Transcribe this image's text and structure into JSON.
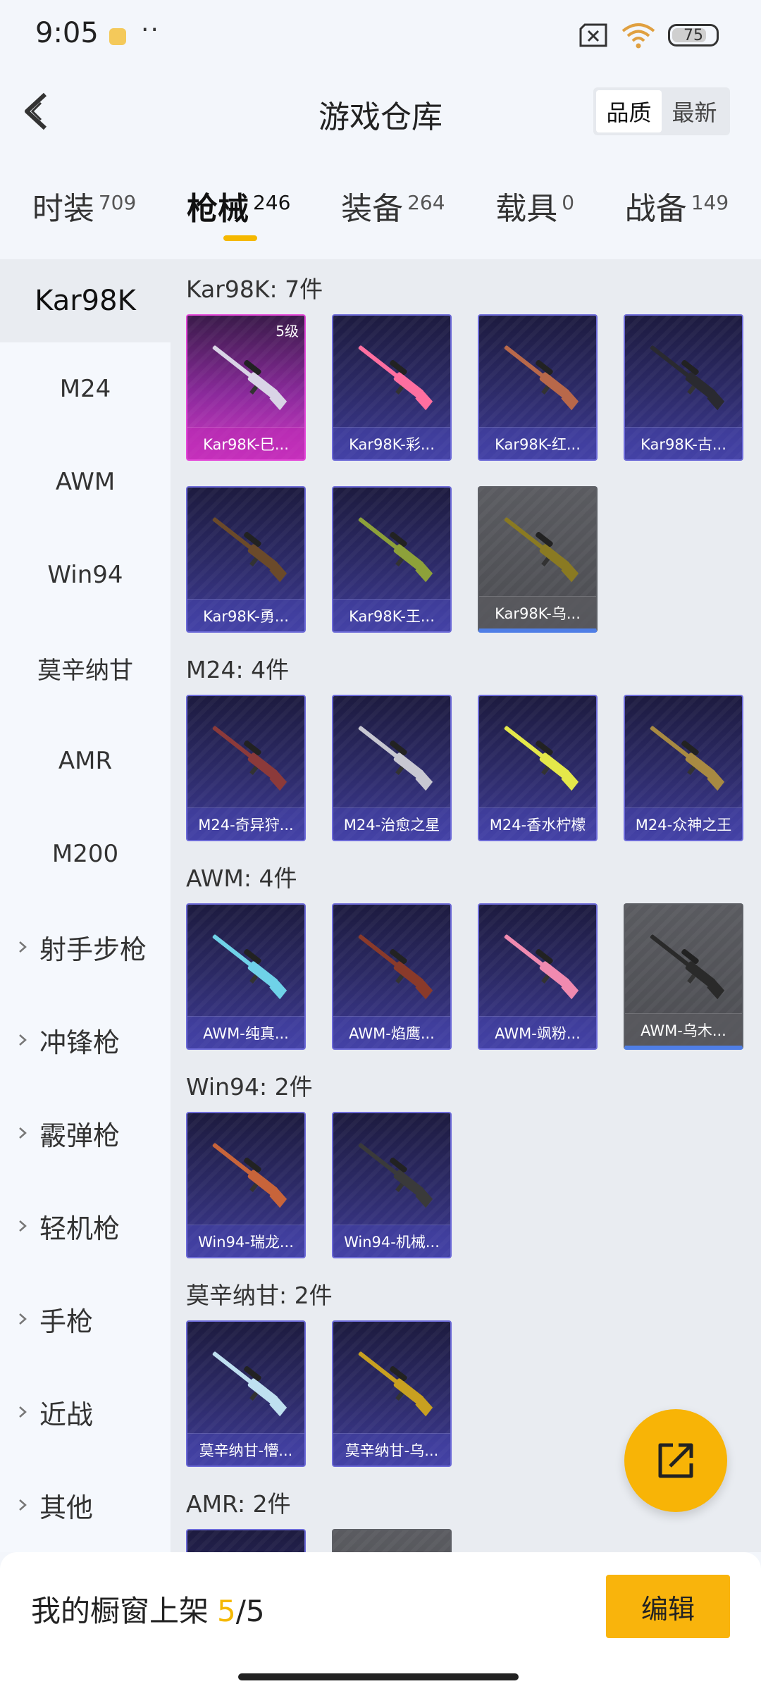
{
  "status_bar": {
    "time": "9:05",
    "more": "··",
    "battery": "75"
  },
  "header": {
    "title": "游戏仓库",
    "sort_options": [
      "品质",
      "最新"
    ],
    "active_sort": "品质"
  },
  "tabs": [
    {
      "label": "时装",
      "count": "709"
    },
    {
      "label": "枪械",
      "count": "246"
    },
    {
      "label": "装备",
      "count": "264"
    },
    {
      "label": "载具",
      "count": "0"
    },
    {
      "label": "战备",
      "count": "149"
    }
  ],
  "sidebar": {
    "items": [
      "Kar98K",
      "M24",
      "AWM",
      "Win94",
      "莫辛纳甘",
      "AMR",
      "M200"
    ],
    "groups": [
      "射手步枪",
      "冲锋枪",
      "霰弹枪",
      "轻机枪",
      "手枪",
      "近战",
      "其他"
    ]
  },
  "sections": [
    {
      "title": "Kar98K: 7件",
      "items": [
        {
          "name": "Kar98K-巳...",
          "level": "5级",
          "rarity": "pink",
          "gun_color": "#d9d4e6"
        },
        {
          "name": "Kar98K-彩...",
          "rarity": "purple",
          "gun_color": "#ff6fa0"
        },
        {
          "name": "Kar98K-红...",
          "rarity": "purple",
          "gun_color": "#b8684a"
        },
        {
          "name": "Kar98K-古...",
          "rarity": "purple",
          "gun_color": "#2a2a30"
        },
        {
          "name": "Kar98K-勇...",
          "rarity": "purple",
          "gun_color": "#6b4a2a"
        },
        {
          "name": "Kar98K-王...",
          "rarity": "purple",
          "gun_color": "#8da13a"
        },
        {
          "name": "Kar98K-乌...",
          "rarity": "grey",
          "gun_color": "#8a7a22"
        }
      ]
    },
    {
      "title": "M24: 4件",
      "items": [
        {
          "name": "M24-奇异狩...",
          "rarity": "purple",
          "gun_color": "#8c3a3a"
        },
        {
          "name": "M24-治愈之星",
          "rarity": "purple",
          "gun_color": "#c8c8d2"
        },
        {
          "name": "M24-香水柠檬",
          "rarity": "purple",
          "gun_color": "#e4e84a"
        },
        {
          "name": "M24-众神之王",
          "rarity": "purple",
          "gun_color": "#a88a42"
        }
      ]
    },
    {
      "title": "AWM: 4件",
      "items": [
        {
          "name": "AWM-纯真...",
          "rarity": "purple",
          "gun_color": "#6fd2e8"
        },
        {
          "name": "AWM-焰鹰...",
          "rarity": "purple",
          "gun_color": "#8a3a2a"
        },
        {
          "name": "AWM-飒粉...",
          "rarity": "purple",
          "gun_color": "#f08ab0"
        },
        {
          "name": "AWM-乌木...",
          "rarity": "grey",
          "gun_color": "#2a2a2a"
        }
      ]
    },
    {
      "title": "Win94: 2件",
      "items": [
        {
          "name": "Win94-瑞龙...",
          "rarity": "purple",
          "gun_color": "#c8643a"
        },
        {
          "name": "Win94-机械...",
          "rarity": "purple",
          "gun_color": "#3a3a3a"
        }
      ]
    },
    {
      "title": "莫辛纳甘: 2件",
      "items": [
        {
          "name": "莫辛纳甘-懵...",
          "rarity": "purple",
          "gun_color": "#bfe0f0"
        },
        {
          "name": "莫辛纳甘-乌...",
          "rarity": "purple",
          "gun_color": "#c8a020"
        }
      ]
    },
    {
      "title": "AMR: 2件",
      "items": []
    }
  ],
  "bottom": {
    "showcase_label": "我的橱窗上架",
    "showcase_used": "5",
    "showcase_total": "/5",
    "edit_label": "编辑"
  },
  "colors": {
    "accent": "#f8b406",
    "pink_rarity": "#cf39c4",
    "purple_rarity": "#3d3a93"
  }
}
